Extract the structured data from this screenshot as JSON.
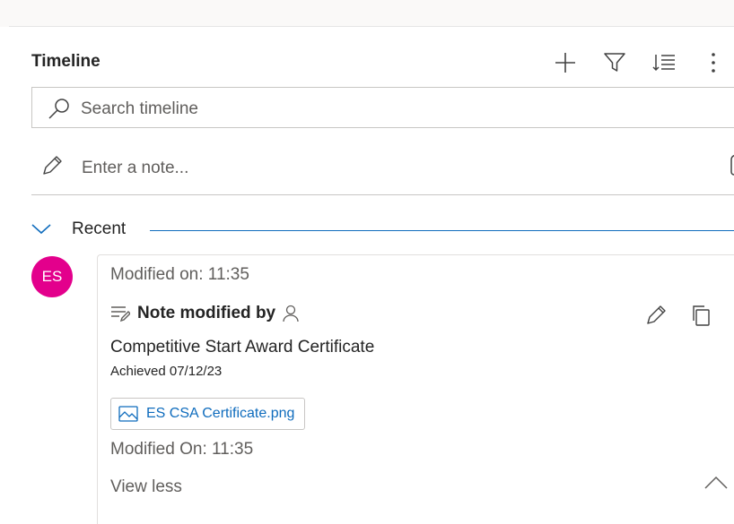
{
  "timeline": {
    "title": "Timeline",
    "search_placeholder": "Search timeline",
    "note_placeholder": "Enter a note...",
    "section_label": "Recent",
    "accent_color": "#0f6cbd"
  },
  "header_icons": [
    "add-icon",
    "filter-icon",
    "sort-icon",
    "more-options-icon"
  ],
  "record": {
    "avatar_initials": "ES",
    "avatar_color": "#e3008c",
    "modified_top": "Modified on: 11:35",
    "heading": "Note modified by",
    "title": "Competitive Start Award Certificate",
    "subtitle": "Achieved 07/12/23",
    "attachment_name": "ES CSA Certificate.png",
    "modified_bottom": "Modified On: 11:35",
    "toggle_label": "View less"
  }
}
